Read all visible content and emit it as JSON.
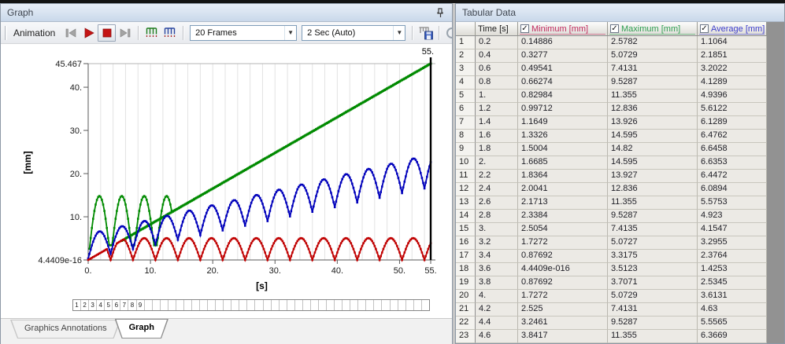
{
  "graph_panel": {
    "title": "Graph",
    "toolbar": {
      "animation_label": "Animation",
      "frames_select": "20 Frames",
      "duration_select": "2 Sec (Auto)"
    },
    "frame_strip": {
      "total_cells": 45,
      "numbered_labels": [
        "1",
        "2",
        "3",
        "4",
        "5",
        "6",
        "7",
        "8",
        "9"
      ]
    },
    "tabs": [
      {
        "label": "Graphics Annotations",
        "active": false
      },
      {
        "label": "Graph",
        "active": true
      }
    ]
  },
  "tabular_panel": {
    "title": "Tabular Data",
    "columns": [
      {
        "label": "Time [s]",
        "color": "#1a1a1a",
        "checkbox": false
      },
      {
        "label": "Minimum [mm]",
        "color": "#c22a5e",
        "checkbox": true,
        "checked": true
      },
      {
        "label": "Maximum [mm]",
        "color": "#2e9e50",
        "checkbox": true,
        "checked": true
      },
      {
        "label": "Average [mm]",
        "color": "#3d3dcc",
        "checkbox": true,
        "checked": true
      }
    ],
    "rows": [
      [
        "1",
        "0.2",
        "0.14886",
        "2.5782",
        "1.1064"
      ],
      [
        "2",
        "0.4",
        "0.3277",
        "5.0729",
        "2.1851"
      ],
      [
        "3",
        "0.6",
        "0.49541",
        "7.4131",
        "3.2022"
      ],
      [
        "4",
        "0.8",
        "0.66274",
        "9.5287",
        "4.1289"
      ],
      [
        "5",
        "1.",
        "0.82984",
        "11.355",
        "4.9396"
      ],
      [
        "6",
        "1.2",
        "0.99712",
        "12.836",
        "5.6122"
      ],
      [
        "7",
        "1.4",
        "1.1649",
        "13.926",
        "6.1289"
      ],
      [
        "8",
        "1.6",
        "1.3326",
        "14.595",
        "6.4762"
      ],
      [
        "9",
        "1.8",
        "1.5004",
        "14.82",
        "6.6458"
      ],
      [
        "10",
        "2.",
        "1.6685",
        "14.595",
        "6.6353"
      ],
      [
        "11",
        "2.2",
        "1.8364",
        "13.927",
        "6.4472"
      ],
      [
        "12",
        "2.4",
        "2.0041",
        "12.836",
        "6.0894"
      ],
      [
        "13",
        "2.6",
        "2.1713",
        "11.355",
        "5.5753"
      ],
      [
        "14",
        "2.8",
        "2.3384",
        "9.5287",
        "4.923"
      ],
      [
        "15",
        "3.",
        "2.5054",
        "7.4135",
        "4.1547"
      ],
      [
        "16",
        "3.2",
        "1.7272",
        "5.0727",
        "3.2955"
      ],
      [
        "17",
        "3.4",
        "0.87692",
        "3.3175",
        "2.3764"
      ],
      [
        "18",
        "3.6",
        "4.4409e-016",
        "3.5123",
        "1.4253"
      ],
      [
        "19",
        "3.8",
        "0.87692",
        "3.7071",
        "2.5345"
      ],
      [
        "20",
        "4.",
        "1.7272",
        "5.0729",
        "3.6131"
      ],
      [
        "21",
        "4.2",
        "2.525",
        "7.4131",
        "4.63"
      ],
      [
        "22",
        "4.4",
        "3.2461",
        "9.5287",
        "5.5565"
      ],
      [
        "23",
        "4.6",
        "3.8417",
        "11.355",
        "6.3669"
      ]
    ]
  },
  "chart_data": {
    "type": "line",
    "xlabel": "[s]",
    "ylabel": "[mm]",
    "xlim": [
      0,
      55.5
    ],
    "ylim": [
      0,
      45.467
    ],
    "grid_step_x": 2,
    "x_ticks": [
      {
        "v": 0,
        "label": "0."
      },
      {
        "v": 10,
        "label": "10."
      },
      {
        "v": 20,
        "label": "20."
      },
      {
        "v": 30,
        "label": "30."
      },
      {
        "v": 40,
        "label": "40."
      },
      {
        "v": 50,
        "label": "50."
      },
      {
        "v": 55,
        "label": "55."
      }
    ],
    "y_ticks": [
      {
        "v": 0,
        "label": "4.4409e-16"
      },
      {
        "v": 10,
        "label": "10."
      },
      {
        "v": 20,
        "label": "20."
      },
      {
        "v": 30,
        "label": "30."
      },
      {
        "v": 40,
        "label": "40."
      },
      {
        "v": 45.467,
        "label": "45.467"
      }
    ],
    "cursor": {
      "time": 55,
      "label": "55."
    },
    "sample_step": 0.2,
    "series": [
      {
        "name": "Minimum",
        "color": "#c00000",
        "kind": "min_clip",
        "period": 3.6,
        "peak": 5.05,
        "ramp_slope": 0.835,
        "t_range": [
          0,
          55
        ],
        "width": 1.8,
        "marker": 2.6
      },
      {
        "name": "Maximum-oscillation",
        "color": "#008a00",
        "kind": "abs_sine",
        "period": 3.6,
        "peak": 14.82,
        "floor": 3.4,
        "floor_after_t": 3,
        "t_range": [
          0.2,
          13.4
        ],
        "width": 1.8,
        "marker": 2.6
      },
      {
        "name": "Maximum-trend",
        "color": "#008a00",
        "kind": "linear",
        "from": [
          5.4,
          4.46
        ],
        "to": [
          55,
          45.467
        ],
        "t_range": [
          5.4,
          55
        ],
        "width": 2.4,
        "marker": 3
      },
      {
        "name": "Average",
        "color": "#0000bb",
        "kind": "abs_sine_envelope",
        "period": 3.6,
        "valley": {
          "base": 0.35,
          "slope": 0.3
        },
        "peak": {
          "base": 6.0,
          "slope": 0.335
        },
        "t_range": [
          0,
          55
        ],
        "width": 1.8,
        "marker": 2.6
      }
    ],
    "draw_order": [
      2,
      1,
      3,
      0
    ]
  }
}
